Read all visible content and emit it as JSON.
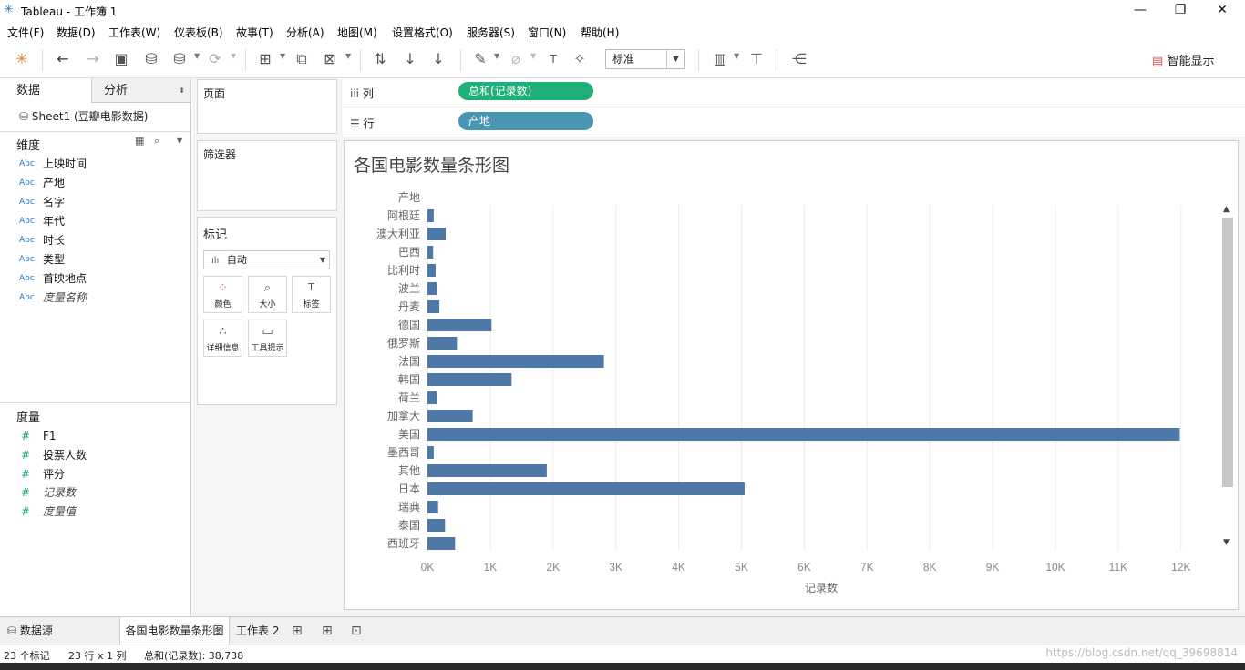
{
  "window": {
    "title": "Tableau - 工作簿 1",
    "minimize": "—",
    "restore": "❐",
    "close": "✕"
  },
  "menu": [
    "文件(F)",
    "数据(D)",
    "工作表(W)",
    "仪表板(B)",
    "故事(T)",
    "分析(A)",
    "地图(M)",
    "设置格式(O)",
    "服务器(S)",
    "窗口(N)",
    "帮助(H)"
  ],
  "toolbar": {
    "fit_value": "标准",
    "show_me": "智能显示"
  },
  "left": {
    "tab_data": "数据",
    "tab_analysis": "分析",
    "datasource": "Sheet1 (豆瓣电影数据)",
    "dimensions_title": "维度",
    "dimensions": [
      "上映时间",
      "产地",
      "名字",
      "年代",
      "时长",
      "类型",
      "首映地点",
      "度量名称"
    ],
    "dim_type": "Abc",
    "measures_title": "度量",
    "measures": [
      "F1",
      "投票人数",
      "评分",
      "记录数",
      "度量值"
    ],
    "measure_type": "#"
  },
  "cards": {
    "pages": "页面",
    "filters": "筛选器",
    "marks": "标记",
    "mark_type": "自动",
    "buttons": [
      "颜色",
      "大小",
      "标签",
      "详细信息",
      "工具提示"
    ]
  },
  "shelves": {
    "columns_label": "列",
    "columns_pill": "总和(记录数)",
    "columns_color": "#1fb07a",
    "rows_label": "行",
    "rows_pill": "产地",
    "rows_color": "#4996b2"
  },
  "viz": {
    "title": "各国电影数量条形图"
  },
  "chart_data": {
    "type": "bar",
    "orientation": "horizontal",
    "title": "各国电影数量条形图",
    "ylabel": "产地",
    "xlabel": "记录数",
    "categories": [
      "阿根廷",
      "澳大利亚",
      "巴西",
      "比利时",
      "波兰",
      "丹麦",
      "德国",
      "俄罗斯",
      "法国",
      "韩国",
      "荷兰",
      "加拿大",
      "美国",
      "墨西哥",
      "其他",
      "日本",
      "瑞典",
      "泰国",
      "西班牙"
    ],
    "values": [
      100,
      290,
      90,
      130,
      150,
      190,
      1020,
      470,
      2810,
      1340,
      150,
      720,
      11980,
      100,
      1900,
      5050,
      170,
      280,
      440
    ],
    "xlim": [
      0,
      12500
    ],
    "xticks": [
      "0K",
      "1K",
      "2K",
      "3K",
      "4K",
      "5K",
      "6K",
      "7K",
      "8K",
      "9K",
      "10K",
      "11K",
      "12K"
    ],
    "bar_color": "#4e79a7",
    "grid": true
  },
  "sheet_tabs": {
    "datasource": "数据源",
    "sheet1": "各国电影数量条形图",
    "sheet2": "工作表 2"
  },
  "status": {
    "marks": "23 个标记",
    "dims": "23 行 x 1 列",
    "sum": "总和(记录数): 38,738",
    "watermark": "https://blog.csdn.net/qq_39698814"
  }
}
